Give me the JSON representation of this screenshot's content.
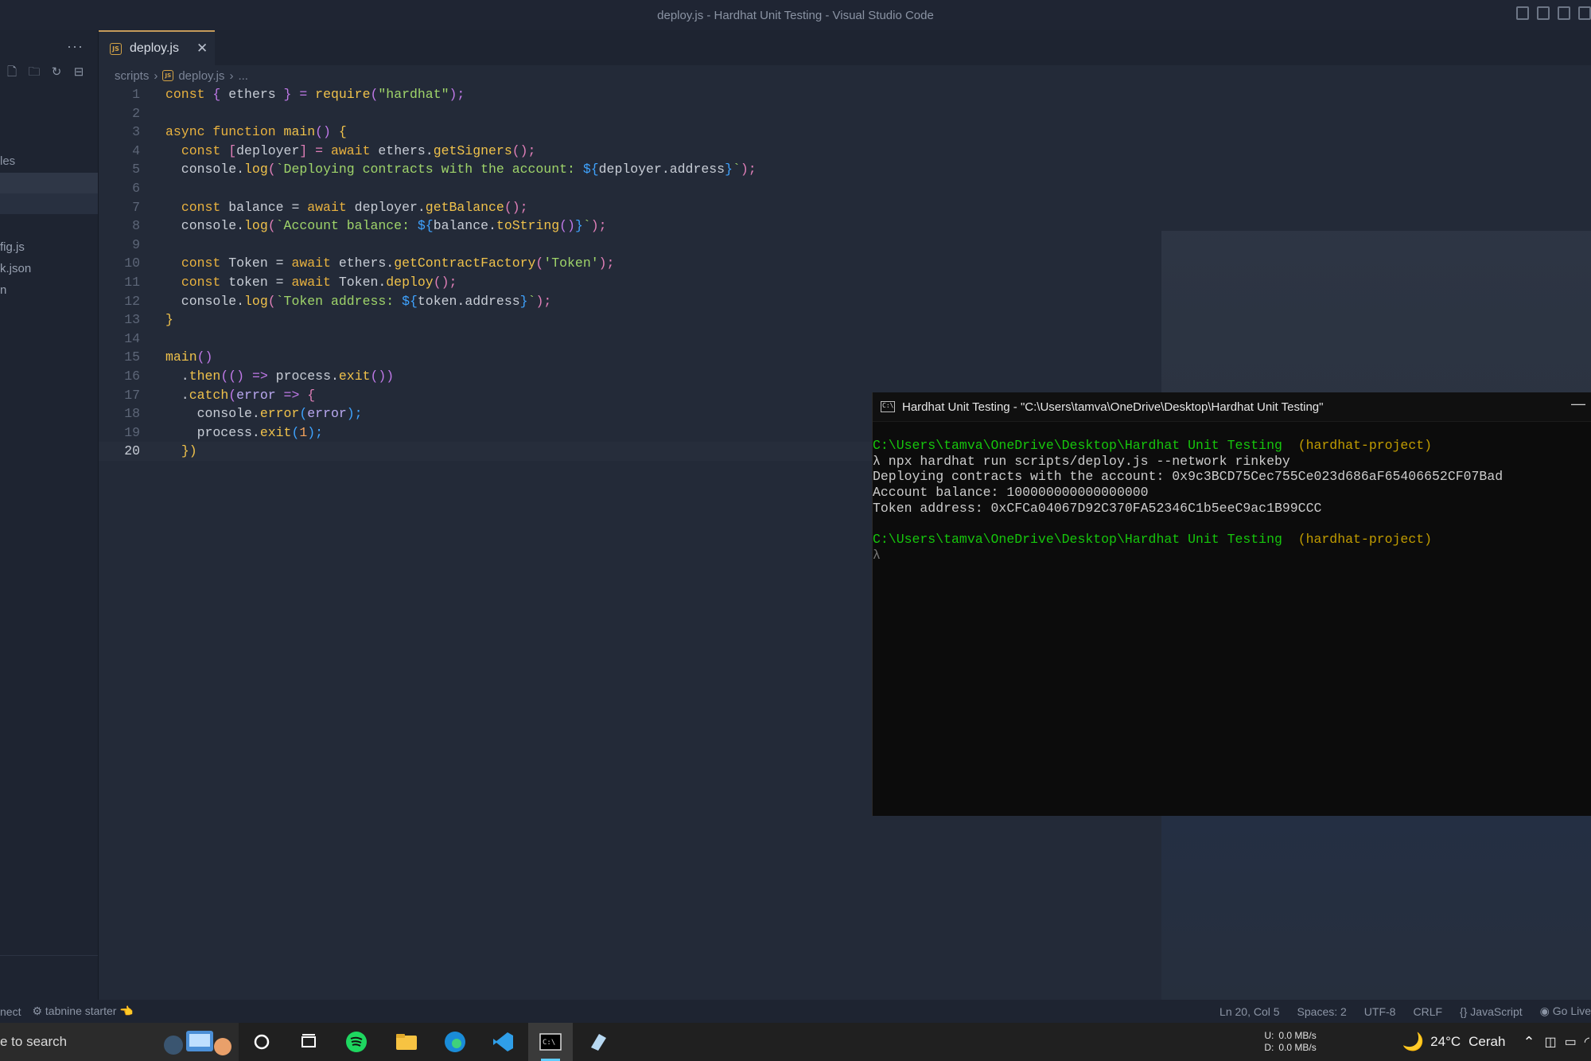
{
  "window": {
    "title": "deploy.js - Hardhat Unit Testing - Visual Studio Code"
  },
  "sidebar": {
    "more": "···",
    "section_label": "les",
    "files": [
      "fig.js",
      "k.json",
      "n"
    ]
  },
  "tab": {
    "label": "deploy.js",
    "close": "✕"
  },
  "breadcrumb": {
    "folder": "scripts",
    "file": "deploy.js",
    "more": "..."
  },
  "editor": {
    "current_line": 20,
    "lines": [
      {
        "n": "1"
      },
      {
        "n": "2"
      },
      {
        "n": "3"
      },
      {
        "n": "4"
      },
      {
        "n": "5"
      },
      {
        "n": "6"
      },
      {
        "n": "7"
      },
      {
        "n": "8"
      },
      {
        "n": "9"
      },
      {
        "n": "10"
      },
      {
        "n": "11"
      },
      {
        "n": "12"
      },
      {
        "n": "13"
      },
      {
        "n": "14"
      },
      {
        "n": "15"
      },
      {
        "n": "16"
      },
      {
        "n": "17"
      },
      {
        "n": "18"
      },
      {
        "n": "19"
      },
      {
        "n": "20"
      }
    ],
    "tokens": {
      "l1": [
        "const",
        " { ",
        "ethers",
        " } = ",
        "require",
        "(",
        "\"hardhat\"",
        ");"
      ],
      "l3": [
        "async",
        " ",
        "function",
        " ",
        "main",
        "() ",
        "{"
      ],
      "l4": [
        "  ",
        "const",
        " [",
        "deployer",
        "] = ",
        "await",
        " ethers.",
        "getSigners",
        "();"
      ],
      "l5": [
        "  console.",
        "log",
        "(",
        "`Deploying contracts with the account: ",
        "${",
        "deployer.address",
        "}",
        "`",
        ");"
      ],
      "l7": [
        "  ",
        "const",
        " balance = ",
        "await",
        " deployer.",
        "getBalance",
        "();"
      ],
      "l8": [
        "  console.",
        "log",
        "(",
        "`Account balance: ",
        "${",
        "balance.",
        "toString",
        "()",
        "}",
        "`",
        ");"
      ],
      "l10": [
        "  ",
        "const",
        " Token = ",
        "await",
        " ethers.",
        "getContractFactory",
        "(",
        "'Token'",
        ");"
      ],
      "l11": [
        "  ",
        "const",
        " token = ",
        "await",
        " Token.",
        "deploy",
        "();"
      ],
      "l12": [
        "  console.",
        "log",
        "(",
        "`Token address: ",
        "${",
        "token.address",
        "}",
        "`",
        ");"
      ],
      "l13": [
        "}"
      ],
      "l15": [
        "main",
        "()"
      ],
      "l16": [
        "  .",
        "then",
        "((",
        ") ",
        "=>",
        " process.",
        "exit",
        "())"
      ],
      "l17": [
        "  .",
        "catch",
        "(",
        "error",
        " => ",
        "{"
      ],
      "l18": [
        "    console.",
        "error",
        "(",
        "error",
        ");"
      ],
      "l19": [
        "    process.",
        "exit",
        "(",
        "1",
        ");"
      ],
      "l20": [
        "  ",
        "})"
      ]
    }
  },
  "terminal": {
    "title": "Hardhat Unit Testing - \"C:\\Users\\tamva\\OneDrive\\Desktop\\Hardhat Unit Testing\"",
    "minimize": "—",
    "path1": "C:\\Users\\tamva\\OneDrive\\Desktop\\Hardhat Unit Testing",
    "env1": "(hardhat-project)",
    "cmd": "λ npx hardhat run scripts/deploy.js --network rinkeby",
    "out1": "Deploying contracts with the account: 0x9c3BCD75Cec755Ce023d686aF65406652CF07Bad",
    "out2": "Account balance: 100000000000000000",
    "out3": "Token address: 0xCFCa04067D92C370FA52346C1b5eeC9ac1B99CCC",
    "path2": "C:\\Users\\tamva\\OneDrive\\Desktop\\Hardhat Unit Testing",
    "env2": "(hardhat-project)",
    "prompt": "λ"
  },
  "statusbar": {
    "left1": "nect",
    "tabnine": "tabnine starter",
    "position": "Ln 20, Col 5",
    "spaces": "Spaces: 2",
    "encoding": "UTF-8",
    "eol": "CRLF",
    "language": "JavaScript",
    "golive": "Go Live"
  },
  "taskbar": {
    "search": "e to search",
    "net_up_label": "U:",
    "net_down_label": "D:",
    "net_up": "0.0 MB/s",
    "net_down": "0.0 MB/s",
    "weather_temp": "24°C",
    "weather_text": "Cerah"
  },
  "colors": {
    "accent": "#c49a5a",
    "terminal_green": "#16c60c",
    "terminal_gold": "#c19c00"
  }
}
